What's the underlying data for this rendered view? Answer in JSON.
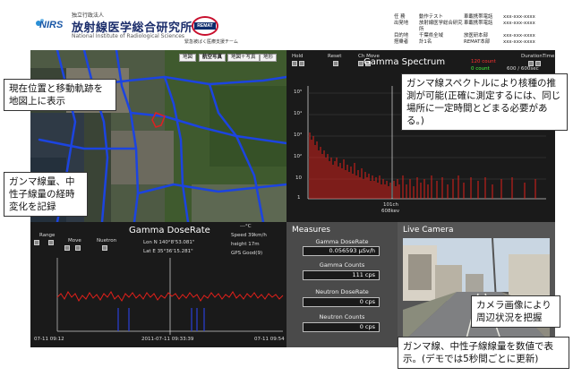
{
  "header": {
    "org_small": "独立行政法人",
    "org_name": "放射線医学総合研究所",
    "org_english": "National Institute of Radiological Sciences",
    "logo_text": "NIRS",
    "remat_text": "REMAT",
    "remat_caption": "緊急被ばく医療支援チーム"
  },
  "info_table": {
    "rows": [
      {
        "k": "任 務",
        "v": "動作テスト",
        "k2": "車載携帯電話",
        "v2": "xxx-xxx-xxxx"
      },
      {
        "k": "出発地",
        "v": "放射線医学総合研究所",
        "k2": "車載携帯電話",
        "v2": "xxx-xxx-xxxx"
      },
      {
        "k": "目的地",
        "v": "千葉県全域",
        "k2": "放医研本部",
        "v2": "xxx-xxx-xxxx"
      },
      {
        "k": "搭乗者",
        "v": "計1名",
        "k2": "REMAT本部",
        "v2": "xxx-xxx-xxxx"
      }
    ]
  },
  "map": {
    "buttons": [
      "地図",
      "航空写真",
      "地図＋写真",
      "地形"
    ]
  },
  "spectrum": {
    "title": "Gamma Spectrum",
    "controls": {
      "hold": "Hold",
      "reset": "Reset",
      "ch_move": "Ch Move",
      "duration": "DurationTime"
    },
    "count_red": "120 count",
    "count_green": "0 count",
    "duration_value": "600 / 600sec",
    "y_ticks": [
      "10⁵",
      "10⁴",
      "10³",
      "10²",
      "10",
      "1"
    ],
    "channel_label": "101ch",
    "kev_label": "608kev"
  },
  "dose": {
    "title": "Gamma DoseRate",
    "temp": "---°C",
    "lon": "Lon N 140°8'53.081\"",
    "lat": "Lat E 35°36'15.281\"",
    "speed": "Speed 39km/h",
    "height": "height 17m",
    "gps": "GPS Good(9)",
    "range": "Range",
    "move": "Move",
    "neutron": "Nuetron",
    "time_left": "07-11 09:12",
    "time_mid": "2011-07-11 09:33:39",
    "time_right": "07-11 09:54"
  },
  "measures": {
    "title": "Measures",
    "gamma_dose_label": "Gamma DoseRate",
    "gamma_dose_value": "0.056593 μSv/h",
    "gamma_counts_label": "Gamma Counts",
    "gamma_counts_value": "111 cps",
    "neutron_dose_label": "Neutron DoseRate",
    "neutron_dose_value": "0 cps",
    "neutron_counts_label": "Neutron Counts",
    "neutron_counts_value": "0 cps"
  },
  "camera": {
    "title": "Live Camera"
  },
  "callouts": {
    "map_note": "現在位置と移動軌跡を地図上に表示",
    "dose_note": "ガンマ線量、中性子線量の経時変化を記録",
    "spectrum_note": "ガンマ線スペクトルにより核種の推測が可能(正確に測定するには、同じ場所に一定時間とどまる必要がある。)",
    "camera_note": "カメラ画像により周辺状況を把握",
    "measures_note": "ガンマ線、中性子線線量を数値で表示。(デモでは5秒間ごとに更新)"
  },
  "colors": {
    "panel_dark": "#1a1a1a",
    "spectrum_red": "#e0201a",
    "dose_blue": "#2a40d8",
    "map_route": "#1c44e0"
  }
}
